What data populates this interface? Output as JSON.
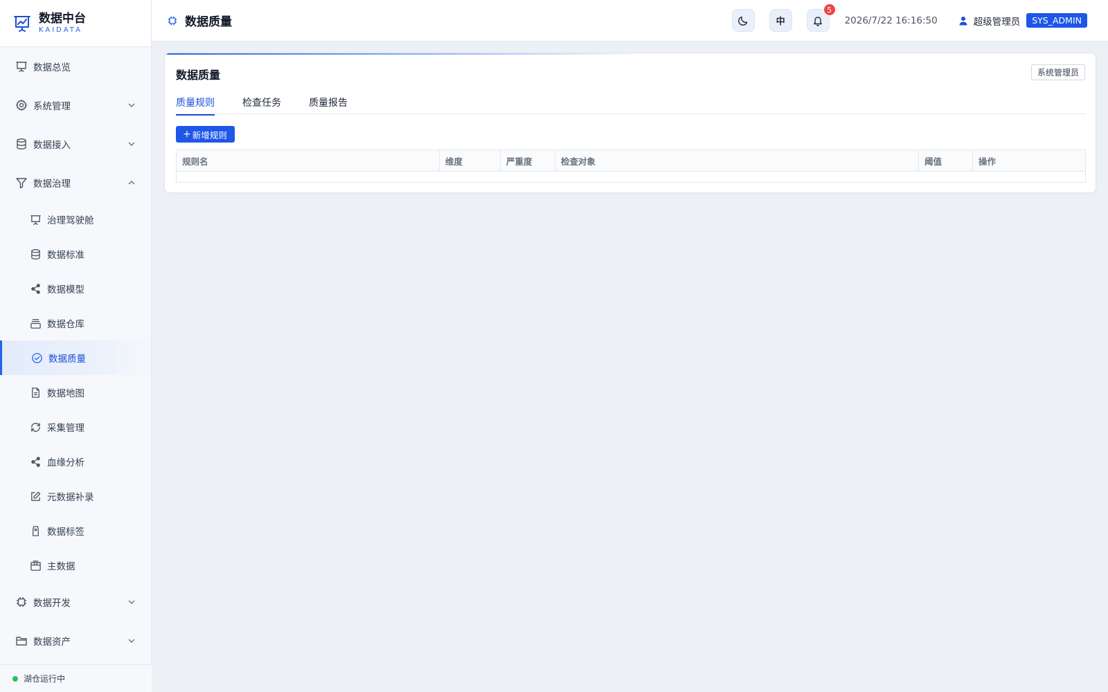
{
  "brand": {
    "name": "数据中台",
    "sub": "KAIDATA"
  },
  "sidebar": {
    "items": [
      {
        "label": "数据总览",
        "icon": "presentation-icon"
      },
      {
        "label": "系统管理",
        "icon": "gear-icon",
        "expandable": true
      },
      {
        "label": "数据接入",
        "icon": "database-icon",
        "expandable": true
      },
      {
        "label": "数据治理",
        "icon": "filter-icon",
        "expanded": true
      }
    ],
    "governance_sub": [
      {
        "label": "治理驾驶舱",
        "icon": "presentation-icon"
      },
      {
        "label": "数据标准",
        "icon": "database-icon"
      },
      {
        "label": "数据模型",
        "icon": "share-icon"
      },
      {
        "label": "数据仓库",
        "icon": "warehouse-icon"
      },
      {
        "label": "数据质量",
        "icon": "check-circle-icon",
        "active": true
      },
      {
        "label": "数据地图",
        "icon": "document-icon"
      },
      {
        "label": "采集管理",
        "icon": "refresh-icon"
      },
      {
        "label": "血缘分析",
        "icon": "share-icon"
      },
      {
        "label": "元数据补录",
        "icon": "edit-icon"
      },
      {
        "label": "数据标签",
        "icon": "tag-icon"
      },
      {
        "label": "主数据",
        "icon": "package-icon"
      }
    ],
    "bottom_items": [
      {
        "label": "数据开发",
        "icon": "chip-icon",
        "expandable": true
      },
      {
        "label": "数据资产",
        "icon": "folder-icon",
        "expandable": true
      }
    ],
    "footer_status": "湖仓运行中"
  },
  "header": {
    "title": "数据质量",
    "lang_label": "中",
    "notification_count": "5",
    "datetime": "2026/7/22 16:16:50",
    "user_name": "超级管理员",
    "role": "SYS_ADMIN"
  },
  "card": {
    "title": "数据质量",
    "tag": "系统管理员",
    "tabs": [
      "质量规则",
      "检查任务",
      "质量报告"
    ],
    "active_tab": 0,
    "add_button": "新增规则",
    "table": {
      "columns": [
        "规则名",
        "维度",
        "严重度",
        "检查对象",
        "阈值",
        "操作"
      ],
      "rows": []
    }
  },
  "colors": {
    "accent": "#1d56e8",
    "active_text": "#1d4ed8",
    "status_ok": "#22c55e",
    "badge": "#ef4444"
  }
}
